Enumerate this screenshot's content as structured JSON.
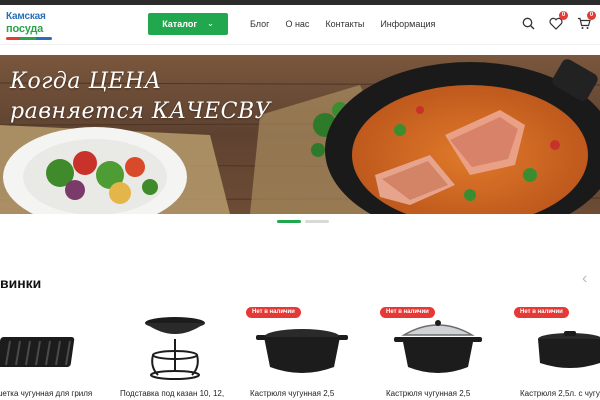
{
  "header": {
    "logo": {
      "line1": "Камская",
      "line2": "посуда"
    },
    "catalog_label": "Каталог",
    "nav": [
      "Блог",
      "О нас",
      "Контакты",
      "Информация"
    ],
    "badges": {
      "favorites": "0",
      "cart": "0"
    },
    "icons": [
      "search-icon",
      "heart-icon",
      "cart-icon"
    ]
  },
  "hero": {
    "line1": "Когда ЦЕНА",
    "line2": "равняется КАЧЕСВУ"
  },
  "slider": {
    "slides": 2,
    "active": 1
  },
  "section": {
    "title": "винки"
  },
  "products": [
    {
      "name": "шетка чугунная для гриля",
      "out_of_stock": false
    },
    {
      "name": "Подставка под казан 10, 12,",
      "out_of_stock": false
    },
    {
      "name": "Кастрюля чугунная 2,5",
      "out_of_stock": true,
      "badge": "Нет в наличии"
    },
    {
      "name": "Кастрюля чугунная 2,5",
      "out_of_stock": true,
      "badge": "Нет в наличии"
    },
    {
      "name": "Кастрюля 2,5л. с чугу",
      "out_of_stock": true,
      "badge": "Нет в наличии"
    }
  ],
  "colors": {
    "brand_green": "#21a84f",
    "badge_red": "#e53935",
    "logo_blue": "#2a6fb5"
  }
}
